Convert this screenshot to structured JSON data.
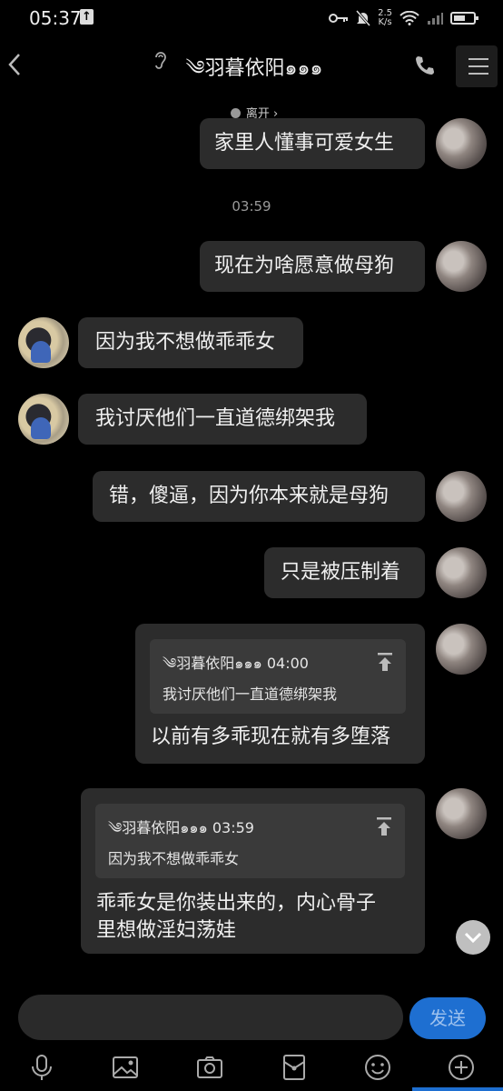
{
  "status_bar": {
    "time": "05:37",
    "speed_top": "2.5",
    "speed_bottom": "K/s"
  },
  "header": {
    "title": "༄羽暮依阳๑๑๑",
    "status": "离开 ›"
  },
  "messages": [
    {
      "side": "me",
      "text": "家里人懂事可爱女生"
    },
    {
      "type": "timestamp",
      "text": "03:59"
    },
    {
      "side": "me",
      "text": "现在为啥愿意做母狗"
    },
    {
      "side": "other",
      "text": "因为我不想做乖乖女"
    },
    {
      "side": "other",
      "text": "我讨厌他们一直道德绑架我"
    },
    {
      "side": "me",
      "text": "错，傻逼，因为你本来就是母狗"
    },
    {
      "side": "me",
      "text": "只是被压制着"
    },
    {
      "side": "me",
      "quote": {
        "author_time": "༄羽暮依阳๑๑๑ 04:00",
        "text": "我讨厌他们一直道德绑架我"
      },
      "text": "以前有多乖现在就有多堕落"
    },
    {
      "side": "me",
      "quote": {
        "author_time": "༄羽暮依阳๑๑๑ 03:59",
        "text": "因为我不想做乖乖女"
      },
      "lines": [
        "乖乖女是你装出来的，内心骨子",
        "里想做淫妇荡娃"
      ]
    }
  ],
  "input": {
    "send_label": "发送"
  },
  "icons": [
    "back-icon",
    "ear-icon",
    "phone-icon",
    "menu-icon",
    "mic-icon",
    "image-icon",
    "camera-icon",
    "red-packet-icon",
    "emoji-icon",
    "plus-icon",
    "pin-icon",
    "chevron-down-icon"
  ],
  "colors": {
    "background": "#000000",
    "bubble": "#2c2c2c",
    "quote": "#3a3a3a",
    "accent": "#1e6fd1"
  }
}
